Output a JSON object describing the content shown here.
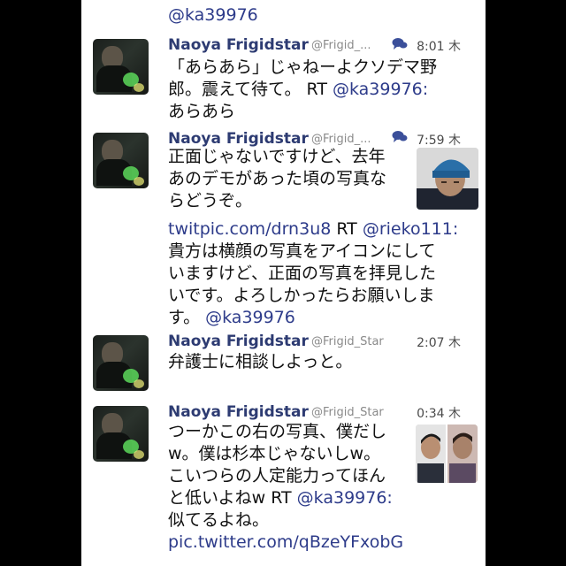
{
  "top_mention": "@ka39976",
  "tweets": [
    {
      "name": "Naoya Frigidstar",
      "handle": "@Frigid_...",
      "time": "8:01 木",
      "lines": [
        "「あらあら」じゃねーよクソデマ野",
        "郎。震えて待て。 RT "
      ],
      "mention": "@ka39976:",
      "tail": "あらあら"
    },
    {
      "name": "Naoya Frigidstar",
      "handle": "@Frigid_...",
      "time": "7:59 木",
      "lines": [
        "正面じゃないですけど、去年",
        "あのデモがあった頃の写真な",
        "らどうぞ。"
      ],
      "link": "twitpic.com/drn3u8",
      "rt": " RT ",
      "mention": "@rieko111:",
      "lines2": [
        "貴方は横顔の写真をアイコンにして",
        "いますけど、正面の写真を拝見した",
        "いです。よろしかったらお願いしま",
        "す。 "
      ],
      "mention2": "@ka39976"
    },
    {
      "name": "Naoya Frigidstar",
      "handle": "@Frigid_Star",
      "time": "2:07 木",
      "lines": [
        "弁護士に相談しよっと。"
      ]
    },
    {
      "name": "Naoya Frigidstar",
      "handle": "@Frigid_Star",
      "time": "0:34 木",
      "lines": [
        "つーかこの右の写真、僕だし",
        "w。僕は杉本じゃないしw。",
        "こいつらの人定能力ってほん",
        "と低いよねw RT "
      ],
      "mention": "@ka39976:",
      "lines2": [
        "似てるよね。"
      ],
      "link": "pic.twitter.com/qBzeYFxobG"
    }
  ],
  "colors": {
    "name": "#2d3b72",
    "link": "#2d3b8a",
    "chat_icon": "#3b4f9a"
  },
  "icons": {
    "conversation": "chat-bubbles-icon"
  }
}
